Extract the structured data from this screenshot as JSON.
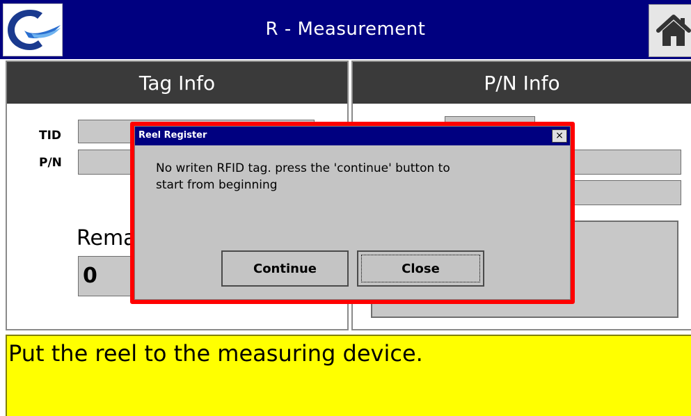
{
  "window": {
    "title": "R - Measurement",
    "logo_icon": "ceyon-technology-logo",
    "home_icon": "home-icon",
    "accent_color": "#000080"
  },
  "tag_info": {
    "header": "Tag Info",
    "tid_label": "TID",
    "pn_label": "P/N",
    "tid_value": "",
    "pn_value": "",
    "remain_label": "Rema",
    "remain_value": "0"
  },
  "pn_info": {
    "header": "P/N Info"
  },
  "status": {
    "message": "Put the reel to the measuring device.",
    "color": "#ffff00"
  },
  "dialog": {
    "title": "Reel Register",
    "close_glyph": "×",
    "message_line1": "No writen RFID tag. press the 'continue' button to",
    "message_line2": "start from beginning",
    "continue_label": "Continue",
    "close_label": "Close",
    "highlight_color": "#ff0000"
  }
}
